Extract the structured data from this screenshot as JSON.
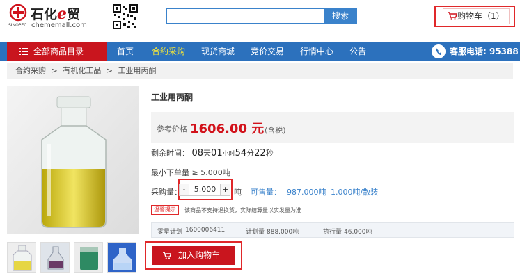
{
  "header": {
    "logo_text": "石化",
    "logo_e": "e",
    "logo_trade": "贸",
    "logo_url": "chememall.com",
    "logo_mark_text": "SINOPEC",
    "search_placeholder": "",
    "search_button": "搜索",
    "cart_label": "购物车（1）"
  },
  "nav": {
    "all_categories": "全部商品目录",
    "items": [
      "首页",
      "合约采购",
      "现货商城",
      "竞价交易",
      "行情中心",
      "公告"
    ],
    "active_index": 1,
    "hotline": "客服电话: 95388"
  },
  "breadcrumb": {
    "items": [
      "合约采购",
      "有机化工品",
      "工业用丙酮"
    ],
    "separator": ">"
  },
  "product": {
    "title": "工业用丙酮",
    "price_label": "参考价格",
    "price_value": "1606.00 元",
    "price_note": "(含税)",
    "countdown_label": "剩余时间：",
    "countdown": {
      "days": "08",
      "days_unit": "天",
      "hours": "01",
      "hours_unit": "小时",
      "minutes": "54",
      "minutes_unit": "分",
      "seconds": "22",
      "seconds_unit": "秒"
    },
    "min_order": "最小下单量 ≥ 5.000吨",
    "qty_label": "采购量：",
    "qty_minus": "-",
    "qty_value": "5.000",
    "qty_plus": "+",
    "qty_unit": "吨",
    "available_label": "可售量：",
    "available_value": "987.000吨",
    "pack": "1.000吨/散装",
    "warning_badge": "温馨提示",
    "warning_text": "该商品不支持退换货，实际结算量以实发量为准",
    "plan": {
      "id_label": "零星计划",
      "id_value": "1600006411",
      "planned_label": "计划量",
      "planned_value": "888.000吨",
      "executed_label": "执行量",
      "executed_value": "46.000吨"
    },
    "add_to_cart": "加入购物车"
  },
  "colors": {
    "brand_red": "#c9151e",
    "nav_blue": "#2c71bd",
    "highlight_frame": "#e0282a",
    "active_nav": "#f2e53b"
  },
  "icons": [
    "qr-code-icon",
    "cart-icon",
    "menu-icon",
    "phone-icon"
  ]
}
